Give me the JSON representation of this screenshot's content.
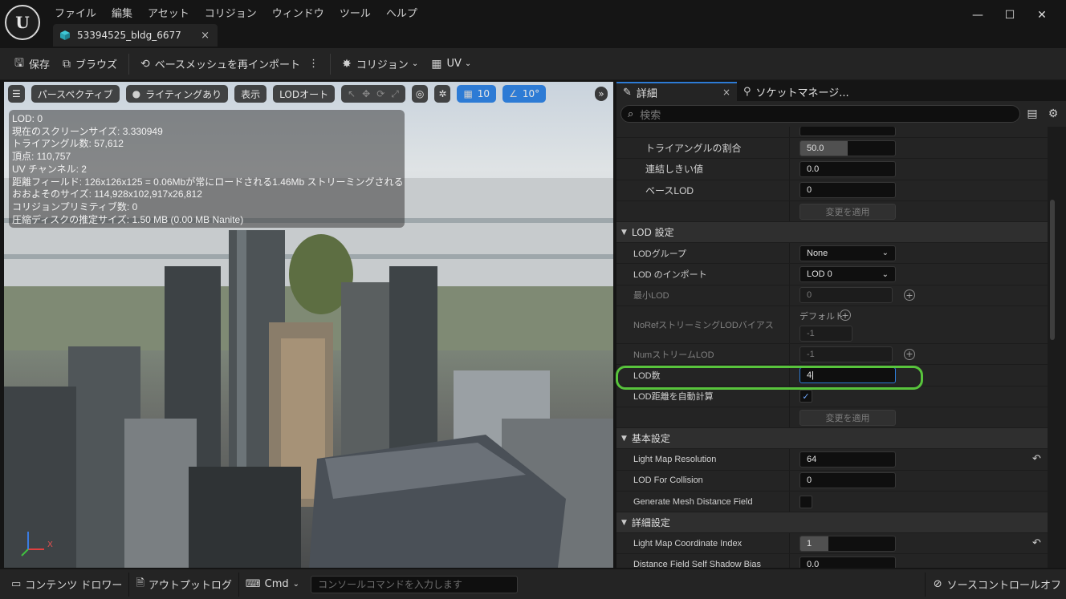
{
  "titlebar": {
    "logo_text": "U",
    "menu": [
      "ファイル",
      "編集",
      "アセット",
      "コリジョン",
      "ウィンドウ",
      "ツール",
      "ヘルプ"
    ],
    "asset_tab": "53394525_bldg_6677",
    "tab_close": "×",
    "window_controls": [
      "—",
      "☐",
      "✕"
    ]
  },
  "toolbar": {
    "save": "保存",
    "browse": "ブラウズ",
    "reimport": "ベースメッシュを再インポート",
    "collision": "コリジョン",
    "uv": "UV"
  },
  "viewport": {
    "toolbar": {
      "perspective": "パースペクティブ",
      "lighting": "ライティングあり",
      "show": "表示",
      "lod": "LODオート",
      "grid_value": "10",
      "angle_value": "10°"
    },
    "stats": [
      "LOD: 0",
      "現在のスクリーンサイズ: 3.330949",
      "トライアングル数: 57,612",
      "頂点: 110,757",
      "UV チャンネル: 2",
      "距離フィールド: 126x126x125 = 0.06Mbが常にロードされる1.46Mb ストリーミングされる",
      "おおよそのサイズ: 114,928x102,917x26,812",
      "コリジョンプリミティブ数: 0",
      "圧縮ディスクの推定サイズ: 1.50 MB (0.00 MB Nanite)"
    ],
    "axis_label": "X",
    "more": "»"
  },
  "details": {
    "tab_details": "詳細",
    "tab_close": "×",
    "tab_socket": "ソケットマネージ...",
    "search_placeholder": "検索",
    "rows_top": {
      "triangle_ratio_label": "トライアングルの割合",
      "triangle_ratio_value": "50.0",
      "triangle_ratio_fraction": 0.5,
      "weld_label": "連結しきい値",
      "weld_value": "0.0",
      "base_lod_label": "ベースLOD",
      "base_lod_value": "0",
      "apply_label": "変更を適用"
    },
    "lod_settings": {
      "header": "LOD 設定",
      "lod_group_label": "LODグループ",
      "lod_group_value": "None",
      "lod_import_label": "LOD のインポート",
      "lod_import_value": "LOD 0",
      "min_lod_label": "最小LOD",
      "min_lod_value": "0",
      "noref_label": "NoRefストリーミングLODバイアス",
      "noref_default": "デフォルト",
      "noref_value": "-1",
      "num_stream_label": "NumストリームLOD",
      "num_stream_value": "-1",
      "lod_count_label": "LOD数",
      "lod_count_value": "4",
      "auto_compute_label": "LOD距離を自動計算",
      "auto_compute_checked": true,
      "apply_label": "変更を適用"
    },
    "general_settings": {
      "header": "基本設定",
      "light_map_res_label": "Light Map Resolution",
      "light_map_res_value": "64",
      "lod_collision_label": "LOD For Collision",
      "lod_collision_value": "0",
      "gen_mesh_df_label": "Generate Mesh Distance Field"
    },
    "advanced_settings": {
      "header": "詳細設定",
      "light_map_coord_label": "Light Map Coordinate Index",
      "light_map_coord_value": "1",
      "light_map_coord_fraction": 0.3,
      "df_shadow_bias_label": "Distance Field Self Shadow Bias",
      "df_shadow_bias_value": "0.0"
    },
    "highlight_color": "#58c43c"
  },
  "bottombar": {
    "content_drawer": "コンテンツ ドロワー",
    "output_log": "アウトプットログ",
    "cmd": "Cmd",
    "console_placeholder": "コンソールコマンドを入力します",
    "source_control": "ソースコントロールオフ"
  }
}
